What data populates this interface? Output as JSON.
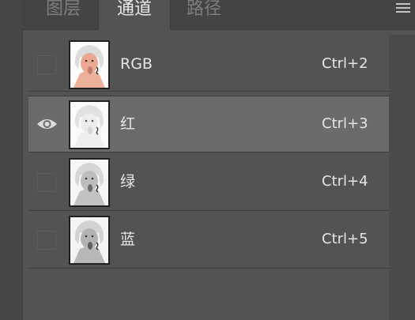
{
  "panel": {
    "tabs": [
      {
        "label": "图层",
        "active": false
      },
      {
        "label": "通道",
        "active": true
      },
      {
        "label": "路径",
        "active": false
      }
    ],
    "menu_icon": "hamburger-menu-icon"
  },
  "channels": [
    {
      "name": "RGB",
      "shortcut": "Ctrl+2",
      "visible": false,
      "selected": false,
      "thumb_tint": "#e9a48f"
    },
    {
      "name": "红",
      "shortcut": "Ctrl+3",
      "visible": true,
      "selected": true,
      "thumb_tint": "#e5e5e5"
    },
    {
      "name": "绿",
      "shortcut": "Ctrl+4",
      "visible": false,
      "selected": false,
      "thumb_tint": "#b0b0b0"
    },
    {
      "name": "蓝",
      "shortcut": "Ctrl+5",
      "visible": false,
      "selected": false,
      "thumb_tint": "#a0a0a0"
    }
  ],
  "colors": {
    "panel_bg": "#535353",
    "selected_row": "#6b6b6b",
    "text": "#e6e6e6",
    "inactive_tab_text": "#7d7d7d"
  }
}
